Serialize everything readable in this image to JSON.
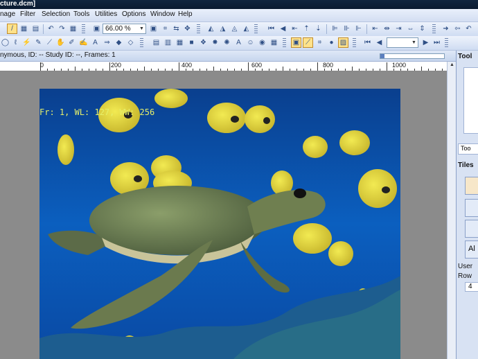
{
  "window": {
    "title": "cture.dcm]"
  },
  "menu": [
    {
      "label": "nage",
      "u": ""
    },
    {
      "label": "Filter",
      "u": "F"
    },
    {
      "label": "Selection",
      "u": "S"
    },
    {
      "label": "Tools",
      "u": "T"
    },
    {
      "label": "Utilities",
      "u": "U"
    },
    {
      "label": "Options",
      "u": "O"
    },
    {
      "label": "Window",
      "u": "W"
    },
    {
      "label": "Help",
      "u": "H"
    }
  ],
  "toolbar": {
    "zoom_value": "66.00 %"
  },
  "document": {
    "info": "nymous, ID: --   Study ID: --, Frames: 1"
  },
  "ruler": {
    "labels": [
      "0",
      "200",
      "400",
      "600",
      "800",
      "1000"
    ]
  },
  "image": {
    "overlay": "Fr: 1, WL: 127, WW: 256"
  },
  "right_panel": {
    "tools_title": "Tool",
    "tab_label": "Too",
    "tiles_title": "Tiles",
    "user_label": "User",
    "rows_label": "Row",
    "rows_value": "4",
    "alt_label": "Al"
  },
  "colors": {
    "accent": "#ffe28a",
    "overlay_text": "#e6f06a",
    "water": "#0e4aa0"
  }
}
